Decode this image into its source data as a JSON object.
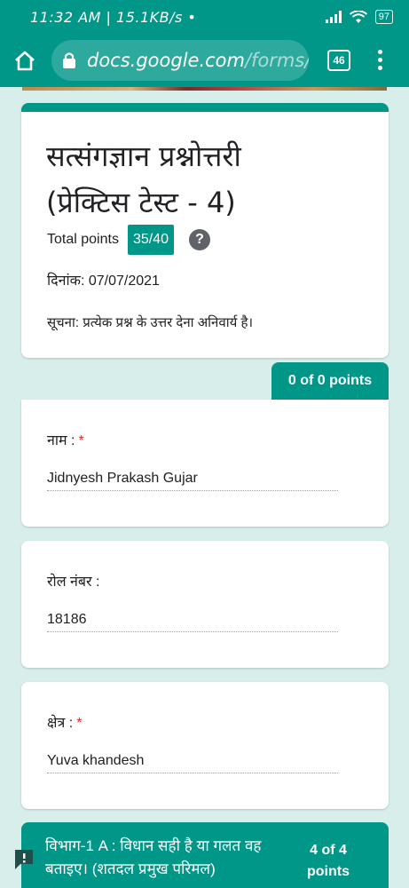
{
  "status_bar": {
    "text": "11:32 AM | 15.1KB/s •",
    "battery": "97"
  },
  "browser": {
    "url_host": "docs.google.com",
    "url_path": "/forms/d",
    "tab_count": "46"
  },
  "form": {
    "title_line1": "सत्संगज्ञान प्रश्नोत्तरी",
    "title_line2": "(प्रेक्टिस टेस्ट - 4)",
    "points_label": "Total points",
    "score": "35/40",
    "help_symbol": "?",
    "date": "दिनांक: 07/07/2021",
    "notice": "सूचना: प्रत्येक प्रश्न के उत्तर देना अनिवार्य है।"
  },
  "section_points": "0 of 0 points",
  "questions": [
    {
      "label": "नाम :",
      "required": "*",
      "answer": "Jidnyesh Prakash Gujar"
    },
    {
      "label": "रोल नंबर :",
      "required": "",
      "answer": "18186"
    },
    {
      "label": "क्षेत्र :",
      "required": "*",
      "answer": "Yuva khandesh"
    }
  ],
  "section2": {
    "title": "विभाग-1 A : विधान सही है या गलत वह बताइए। (शतदल प्रमुख परिमल)",
    "points": "4 of 4 points"
  },
  "colors": {
    "accent": "#009688",
    "background": "#d8eeea",
    "required": "#d93025"
  },
  "icons": [
    "home-icon",
    "lock-icon",
    "menu-icon",
    "help-icon",
    "feedback-icon",
    "wifi-icon",
    "signal-icon"
  ]
}
